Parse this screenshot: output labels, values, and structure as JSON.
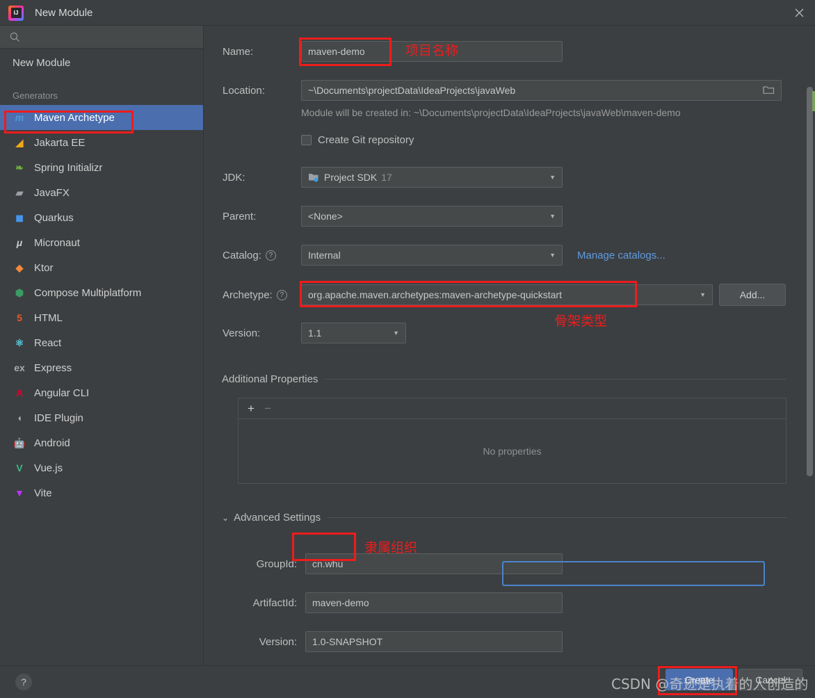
{
  "window": {
    "title": "New Module",
    "app_icon": "intellij-idea-icon",
    "close_icon": "close-icon"
  },
  "sidebar": {
    "search": {
      "placeholder": "",
      "value": "",
      "icon": "search-icon"
    },
    "top_item": {
      "label": "New Module"
    },
    "group_header": "Generators",
    "items": [
      {
        "label": "Maven Archetype",
        "icon": "maven-icon",
        "glyph": "m",
        "color": "#4e9bd8",
        "selected": true
      },
      {
        "label": "Jakarta EE",
        "icon": "jakarta-ee-icon",
        "glyph": "◢",
        "color": "#f0a818",
        "selected": false
      },
      {
        "label": "Spring Initializr",
        "icon": "spring-icon",
        "glyph": "❧",
        "color": "#6db33f",
        "selected": false
      },
      {
        "label": "JavaFX",
        "icon": "javafx-icon",
        "glyph": "▰",
        "color": "#9aa0a6",
        "selected": false
      },
      {
        "label": "Quarkus",
        "icon": "quarkus-icon",
        "glyph": "◼",
        "color": "#4695eb",
        "selected": false
      },
      {
        "label": "Micronaut",
        "icon": "micronaut-icon",
        "glyph": "μ",
        "color": "#c9cbcd",
        "selected": false
      },
      {
        "label": "Ktor",
        "icon": "ktor-icon",
        "glyph": "◆",
        "color": "#f2893b",
        "selected": false
      },
      {
        "label": "Compose Multiplatform",
        "icon": "compose-icon",
        "glyph": "⬢",
        "color": "#3b9c64",
        "selected": false
      },
      {
        "label": "HTML",
        "icon": "html5-icon",
        "glyph": "5",
        "color": "#e8582a",
        "selected": false
      },
      {
        "label": "React",
        "icon": "react-icon",
        "glyph": "⚛",
        "color": "#5bc8de",
        "selected": false
      },
      {
        "label": "Express",
        "icon": "express-icon",
        "glyph": "ex",
        "color": "#a8aaac",
        "selected": false
      },
      {
        "label": "Angular CLI",
        "icon": "angular-icon",
        "glyph": "A",
        "color": "#dd0031",
        "selected": false
      },
      {
        "label": "IDE Plugin",
        "icon": "ide-plugin-icon",
        "glyph": "◖",
        "color": "#a8aaac",
        "selected": false
      },
      {
        "label": "Android",
        "icon": "android-icon",
        "glyph": "🤖",
        "color": "#5ed36a",
        "selected": false
      },
      {
        "label": "Vue.js",
        "icon": "vuejs-icon",
        "glyph": "V",
        "color": "#41b883",
        "selected": false
      },
      {
        "label": "Vite",
        "icon": "vite-icon",
        "glyph": "▼",
        "color": "#bd34fe",
        "selected": false
      }
    ]
  },
  "form": {
    "name": {
      "label": "Name:",
      "value": "maven-demo"
    },
    "location": {
      "label": "Location:",
      "value": "~\\Documents\\projectData\\IdeaProjects\\javaWeb",
      "browse_icon": "folder-icon"
    },
    "created_in_hint": "Module will be created in: ~\\Documents\\projectData\\IdeaProjects\\javaWeb\\maven-demo",
    "git": {
      "label": "Create Git repository",
      "checked": false
    },
    "jdk": {
      "label": "JDK:",
      "value": "Project SDK",
      "version": "17",
      "icon": "jdk-icon"
    },
    "parent": {
      "label": "Parent:",
      "value": "<None>"
    },
    "catalog": {
      "label": "Catalog:",
      "value": "Internal",
      "help_icon": "help-icon",
      "manage_link": "Manage catalogs..."
    },
    "archetype": {
      "label": "Archetype:",
      "value": "org.apache.maven.archetypes:maven-archetype-quickstart",
      "help_icon": "help-icon",
      "add_button": "Add..."
    },
    "version": {
      "label": "Version:",
      "value": "1.1"
    },
    "additional_properties": {
      "title": "Additional Properties",
      "add_icon": "plus-icon",
      "remove_icon": "minus-icon",
      "empty_text": "No properties"
    },
    "advanced": {
      "title": "Advanced Settings",
      "collapse_icon": "chevron-down-icon",
      "group_id": {
        "label": "GroupId:",
        "value": "cn.whu",
        "focused": true
      },
      "artifact_id": {
        "label": "ArtifactId:",
        "value": "maven-demo"
      },
      "version": {
        "label": "Version:",
        "value": "1.0-SNAPSHOT"
      }
    }
  },
  "footer": {
    "help_icon": "help-icon",
    "create_button": "Create",
    "cancel_button": "Cancel"
  },
  "annotations": {
    "color": "#ee1c1c",
    "name_label": "项目名称",
    "archetype_label": "骨架类型",
    "groupid_label": "隶属组织"
  },
  "watermark": {
    "text": "CSDN @奇迹是执着的人创造的"
  }
}
